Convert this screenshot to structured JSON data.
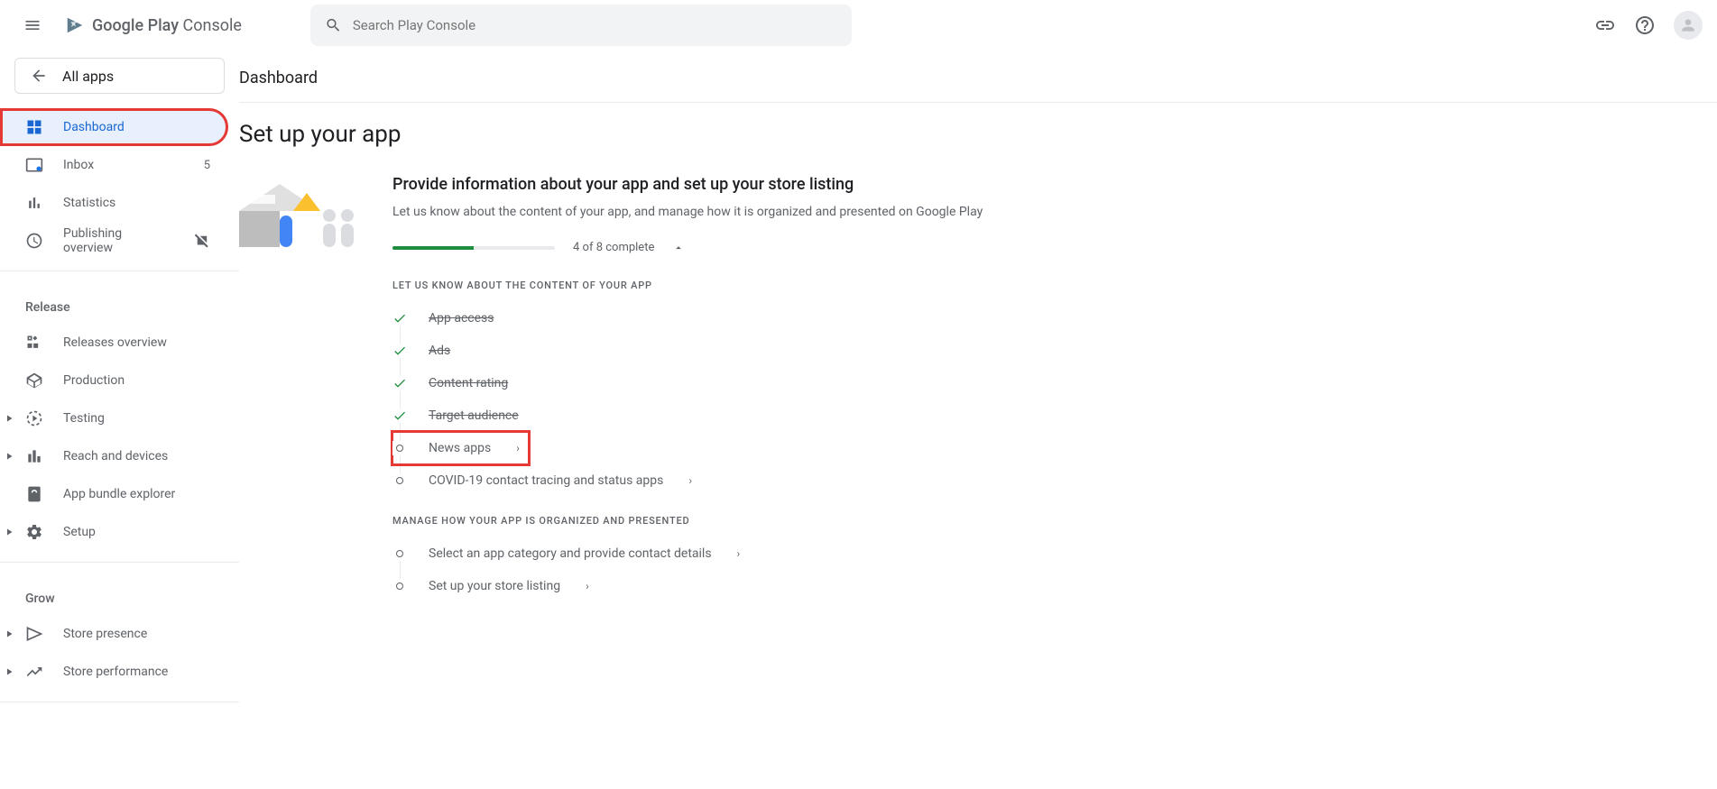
{
  "header": {
    "logo_play": "Google Play",
    "logo_console": "Console",
    "search_placeholder": "Search Play Console"
  },
  "sidebar": {
    "all_apps": "All apps",
    "nav": [
      {
        "label": "Dashboard"
      },
      {
        "label": "Inbox",
        "badge": "5"
      },
      {
        "label": "Statistics"
      },
      {
        "label": "Publishing overview"
      }
    ],
    "release_label": "Release",
    "release": [
      {
        "label": "Releases overview"
      },
      {
        "label": "Production"
      },
      {
        "label": "Testing"
      },
      {
        "label": "Reach and devices"
      },
      {
        "label": "App bundle explorer"
      },
      {
        "label": "Setup"
      }
    ],
    "grow_label": "Grow",
    "grow": [
      {
        "label": "Store presence"
      },
      {
        "label": "Store performance"
      }
    ]
  },
  "main": {
    "page_title": "Dashboard",
    "section_title": "Set up your app",
    "setup_heading": "Provide information about your app and set up your store listing",
    "setup_desc": "Let us know about the content of your app, and manage how it is organized and presented on Google Play",
    "progress_text": "4 of 8 complete",
    "subsection1": "LET US KNOW ABOUT THE CONTENT OF YOUR APP",
    "tasks1": [
      {
        "label": "App access",
        "done": true
      },
      {
        "label": "Ads",
        "done": true
      },
      {
        "label": "Content rating",
        "done": true
      },
      {
        "label": "Target audience",
        "done": true
      },
      {
        "label": "News apps",
        "done": false,
        "highlighted": true
      },
      {
        "label": "COVID-19 contact tracing and status apps",
        "done": false
      }
    ],
    "subsection2": "MANAGE HOW YOUR APP IS ORGANIZED AND PRESENTED",
    "tasks2": [
      {
        "label": "Select an app category and provide contact details",
        "done": false
      },
      {
        "label": "Set up your store listing",
        "done": false
      }
    ]
  }
}
